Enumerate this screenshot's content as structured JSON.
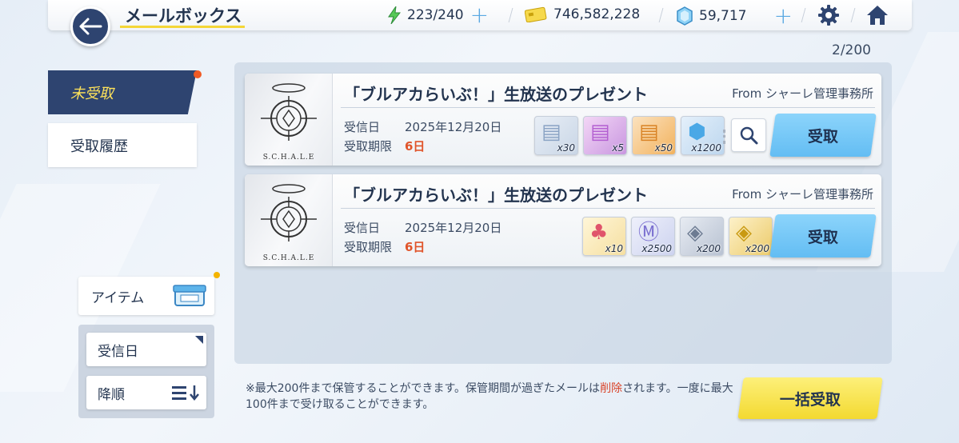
{
  "header": {
    "title": "メールボックス",
    "ap": "223/240",
    "credits": "746,582,228",
    "pyroxene": "59,717"
  },
  "mail_count": "2/200",
  "tabs": [
    {
      "label": "未受取",
      "active": true
    },
    {
      "label": "受取履歴",
      "active": false
    }
  ],
  "mails": [
    {
      "thumb_label": "S.C.H.A.L.E",
      "title": "「ブルアカらいぶ！」生放送のプレゼント",
      "from": "From シャーレ管理事務所",
      "received_label": "受信日",
      "received_date": "2025年12月20日",
      "deadline_label": "受取期限",
      "deadline": "6日",
      "items": [
        {
          "icon": "report-icon",
          "qty": "x30"
        },
        {
          "icon": "pink-report-icon",
          "qty": "x5"
        },
        {
          "icon": "orange-report-icon",
          "qty": "x50"
        },
        {
          "icon": "pyroxene-icon",
          "qty": "x1200"
        }
      ],
      "receive_label": "受取"
    },
    {
      "thumb_label": "S.C.H.A.L.E",
      "title": "「ブルアカらいぶ！」生放送のプレゼント",
      "from": "From シャーレ管理事務所",
      "received_label": "受信日",
      "received_date": "2025年12月20日",
      "deadline_label": "受取期限",
      "deadline": "6日",
      "items": [
        {
          "icon": "cake-icon",
          "qty": "x10"
        },
        {
          "icon": "ticket-icon",
          "qty": "x2500"
        },
        {
          "icon": "silver-box-icon",
          "qty": "x200"
        },
        {
          "icon": "gold-box-icon",
          "qty": "x200"
        }
      ],
      "receive_label": "受取"
    }
  ],
  "filter": {
    "item_label": "アイテム"
  },
  "sort": {
    "by_label": "受信日",
    "order_label": "降順"
  },
  "note": {
    "part1": "※最大200件まで保管することができます。保管期間が過ぎたメールは",
    "highlight": "削除",
    "part2": "されます。一度に最大100件まで受け取ることができます。"
  },
  "bulk_receive_label": "一括受取",
  "colors": {
    "accent_navy": "#2e4470",
    "receive_blue": "#7cc9f8",
    "bulk_yellow": "#f7e34a",
    "deadline_red": "#e0542a"
  }
}
